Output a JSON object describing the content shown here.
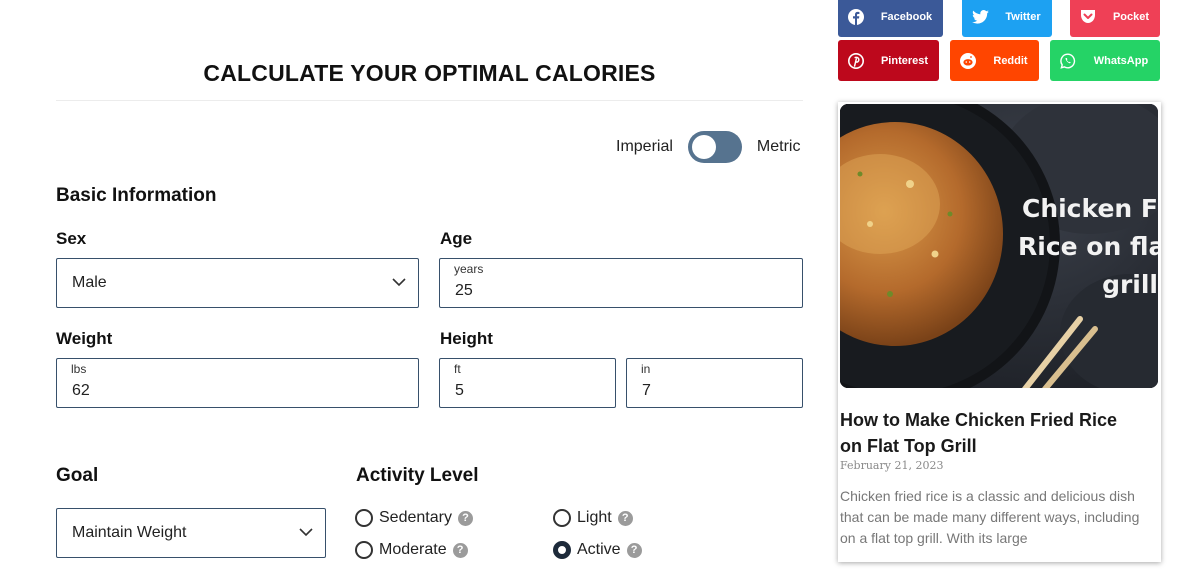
{
  "calculator": {
    "title": "CALCULATE YOUR OPTIMAL CALORIES",
    "units": {
      "imperial_label": "Imperial",
      "metric_label": "Metric",
      "selected": "Imperial"
    },
    "basic_information_heading": "Basic Information",
    "sex": {
      "label": "Sex",
      "value": "Male"
    },
    "age": {
      "label": "Age",
      "unit": "years",
      "value": "25"
    },
    "weight": {
      "label": "Weight",
      "unit": "lbs",
      "value": "62"
    },
    "height": {
      "label": "Height",
      "ft_unit": "ft",
      "ft_value": "5",
      "in_unit": "in",
      "in_value": "7"
    },
    "goal": {
      "label": "Goal",
      "value": "Maintain Weight"
    },
    "activity": {
      "label": "Activity Level",
      "help_glyph": "?",
      "options": [
        {
          "label": "Sedentary",
          "checked": false
        },
        {
          "label": "Light",
          "checked": false
        },
        {
          "label": "Moderate",
          "checked": false
        },
        {
          "label": "Active",
          "checked": true
        }
      ]
    }
  },
  "share": [
    {
      "label": "Facebook",
      "icon": "facebook-icon",
      "color": "#3b5998"
    },
    {
      "label": "Twitter",
      "icon": "twitter-icon",
      "color": "#1da1f2"
    },
    {
      "label": "Pocket",
      "icon": "pocket-icon",
      "color": "#ef4056"
    },
    {
      "label": "Pinterest",
      "icon": "pinterest-icon",
      "color": "#bd081c"
    },
    {
      "label": "Reddit",
      "icon": "reddit-icon",
      "color": "#ff4500"
    },
    {
      "label": "WhatsApp",
      "icon": "whatsapp-icon",
      "color": "#25d366"
    }
  ],
  "article_card": {
    "image_overlay_text": [
      "Chicken F",
      "Rice on fla",
      "grill"
    ],
    "title": "How to Make Chicken Fried Rice on Flat Top Grill",
    "date": "February 21, 2023",
    "excerpt": "Chicken fried rice is a classic and delicious dish that can be made many different ways, including on a flat top grill. With its large"
  },
  "colors": {
    "toggle": "#56738f",
    "field_border": "#37506b"
  }
}
